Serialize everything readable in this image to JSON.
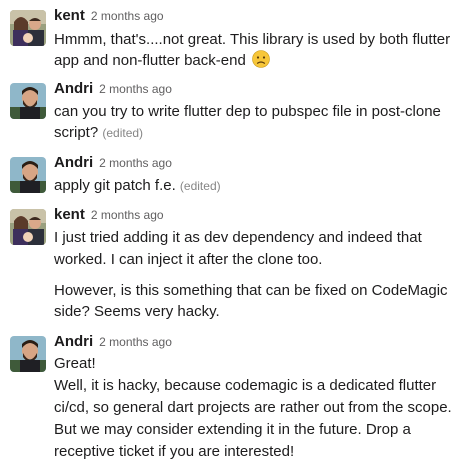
{
  "messages": [
    {
      "author": "kent",
      "time": "2 months ago",
      "avatar_icon": "kent-avatar",
      "lines": [
        "Hmmm, that's....not great. This library is used by both flutter",
        "app and non-flutter back-end"
      ],
      "emoji": "worried-face-emoji"
    },
    {
      "author": "Andri",
      "time": "2 months ago",
      "avatar_icon": "andri-avatar",
      "lines": [
        "can you try to write flutter dep to pubspec file in post-clone",
        "script?"
      ],
      "edited": "(edited)"
    },
    {
      "author": "Andri",
      "time": "2 months ago",
      "avatar_icon": "andri-avatar",
      "lines": [
        "apply git patch f.e."
      ],
      "edited": "(edited)"
    },
    {
      "author": "kent",
      "time": "2 months ago",
      "avatar_icon": "kent-avatar",
      "lines": [
        "I just tried adding it as dev dependency and indeed that",
        "worked. I can inject it after the clone too.",
        "However, is this something that can be fixed on CodeMagic",
        "side? Seems very hacky."
      ]
    },
    {
      "author": "Andri",
      "time": "2 months ago",
      "avatar_icon": "andri-avatar",
      "lines": [
        "Great!",
        "Well, it is hacky, because codemagic is a dedicated flutter",
        "ci/cd, so general dart projects are rather out from the scope.",
        "But we may consider extending it in the future. Drop a",
        "receptive ticket if you are interested!"
      ]
    }
  ],
  "colors": {
    "text": "#1d1c1d",
    "timestamp": "#616061",
    "edited": "#868686",
    "background": "#ffffff"
  }
}
